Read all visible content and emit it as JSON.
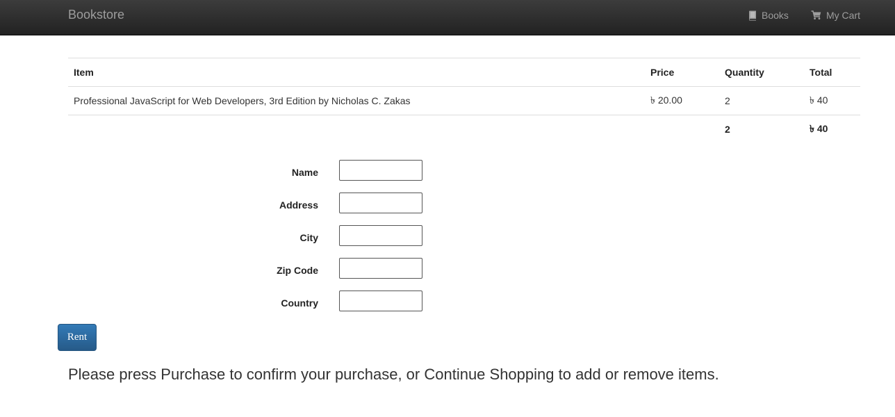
{
  "navbar": {
    "brand": "Bookstore",
    "links": [
      {
        "label": "Books",
        "icon": "book-icon"
      },
      {
        "label": "My Cart",
        "icon": "cart-icon"
      }
    ]
  },
  "cart_table": {
    "headers": [
      "Item",
      "Price",
      "Quantity",
      "Total"
    ],
    "rows": [
      {
        "item": "Professional JavaScript for Web Developers, 3rd Edition by Nicholas C. Zakas",
        "price": "৳ 20.00",
        "quantity": "2",
        "total": "৳ 40"
      }
    ],
    "summary": {
      "quantity": "2",
      "total": "৳ 40"
    }
  },
  "form": {
    "fields": [
      {
        "label": "Name",
        "value": ""
      },
      {
        "label": "Address",
        "value": ""
      },
      {
        "label": "City",
        "value": ""
      },
      {
        "label": "Zip Code",
        "value": ""
      },
      {
        "label": "Country",
        "value": ""
      }
    ]
  },
  "rent_button": {
    "label": "Rent"
  },
  "instruction": "Please press Purchase to confirm your purchase, or Continue Shopping to add or remove items.",
  "colors": {
    "navbar_bg": "#222222",
    "navbar_text": "#9d9d9d",
    "button_primary": "#337ab7"
  }
}
